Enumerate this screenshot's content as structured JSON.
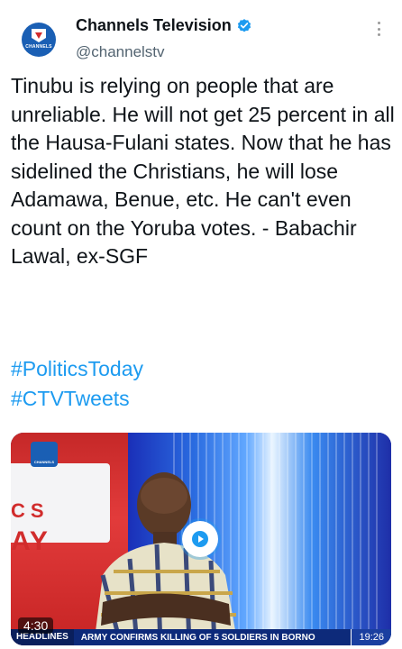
{
  "tweet": {
    "display_name": "Channels Television",
    "handle": "@channelstv",
    "avatar_label": "CHANNELS",
    "text": "Tinubu is relying on people that are unreliable. He will not get 25 percent in all the Hausa-Fulani states. Now that he has sidelined the Christians, he will lose Adamawa, Benue, etc. He can't even count on the Yoruba votes. - Babachir Lawal, ex-SGF",
    "hashtags": [
      "#PoliticsToday",
      "#CTVTweets"
    ]
  },
  "video": {
    "channel_logo_label": "CHANNELS",
    "backdrop_word_1": "CS",
    "backdrop_word_2": "AY",
    "duration": "4:30",
    "ticker_label": "HEADLINES",
    "ticker_text": "ARMY CONFIRMS KILLING OF 5 SOLDIERS IN BORNO",
    "ticker_time": "19:26"
  },
  "colors": {
    "link": "#1d9bf0",
    "verified": "#1d9bf0",
    "muted": "#536471",
    "brand": "#1a5fb4"
  },
  "icons": {
    "verified": "verified-badge-icon",
    "more": "more-options-icon",
    "play": "play-icon"
  }
}
